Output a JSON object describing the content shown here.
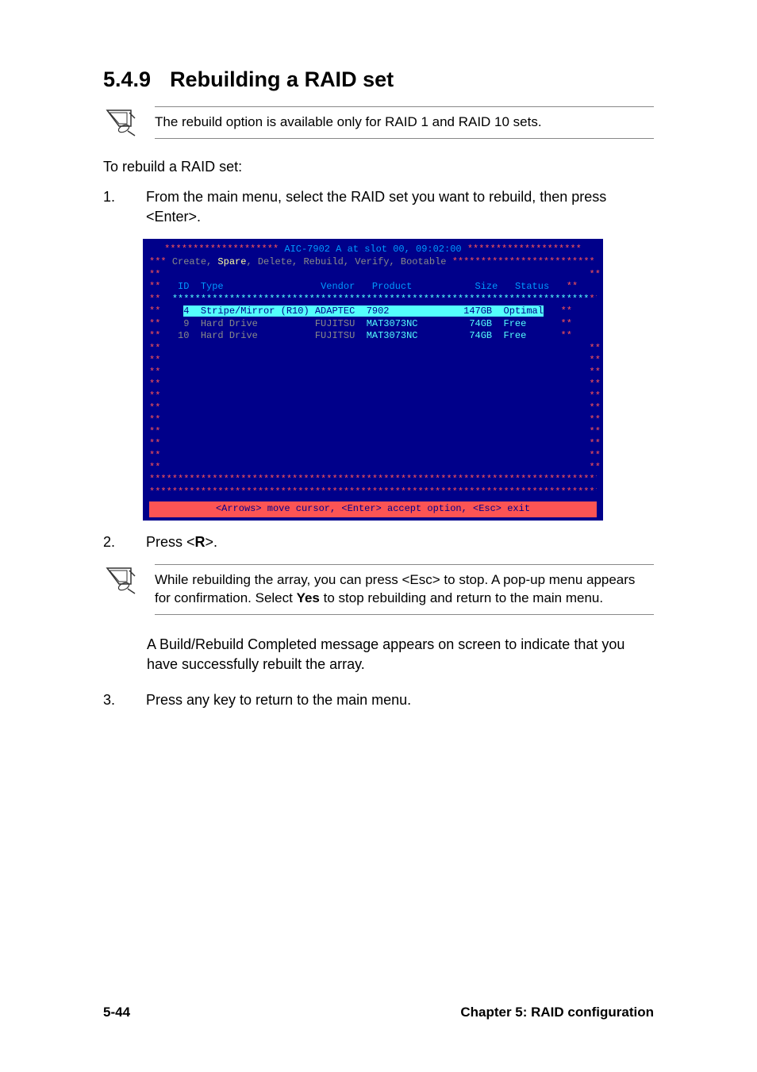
{
  "section": {
    "number": "5.4.9",
    "title": "Rebuilding a RAID set"
  },
  "note1": "The rebuild option is available only for RAID 1 and RAID 10 sets.",
  "intro": "To rebuild a RAID set:",
  "step1": {
    "num": "1.",
    "text": "From the main menu, select the RAID set you want to rebuild, then press <Enter>."
  },
  "bios": {
    "title_bios": "AIC-7902 A at slot 00, 09:02:00",
    "asterisks_lead": "***",
    "menu_items": "Create, Spare, Delete, Rebuild, Verify, Bootable",
    "menu_sel": "Spare",
    "headers": {
      "id": "ID",
      "type": "Type",
      "vendor": "Vendor",
      "product": "Product",
      "size": "Size",
      "status": "Status"
    },
    "rows": [
      {
        "id": "4",
        "type": "Stripe/Mirror (R10)",
        "vendor": "ADAPTEC",
        "product": "7902",
        "size": "147GB",
        "status": "Optimal",
        "selected": true
      },
      {
        "id": "9",
        "type": "Hard Drive",
        "vendor": "FUJITSU",
        "product": "MAT3073NC",
        "size": "74GB",
        "status": "Free",
        "selected": false
      },
      {
        "id": "10",
        "type": "Hard Drive",
        "vendor": "FUJITSU",
        "product": "MAT3073NC",
        "size": "74GB",
        "status": "Free",
        "selected": false
      }
    ],
    "help": "<Arrows> move cursor, <Enter> accept option, <Esc> exit"
  },
  "step2": {
    "num": "2.",
    "prefix": "Press <",
    "key": "R",
    "suffix": ">."
  },
  "note2": {
    "part1": "While rebuilding the array, you can press <Esc> to stop. A pop-up menu appears for confirmation. Select ",
    "yes": "Yes",
    "part2": " to stop rebuilding and return to the main menu."
  },
  "result": "A Build/Rebuild Completed message appears on screen to indicate that you have successfully rebuilt the array.",
  "step3": {
    "num": "3.",
    "text": "Press any key to return to the main menu."
  },
  "footer": {
    "left": "5-44",
    "right": "Chapter 5: RAID configuration"
  }
}
